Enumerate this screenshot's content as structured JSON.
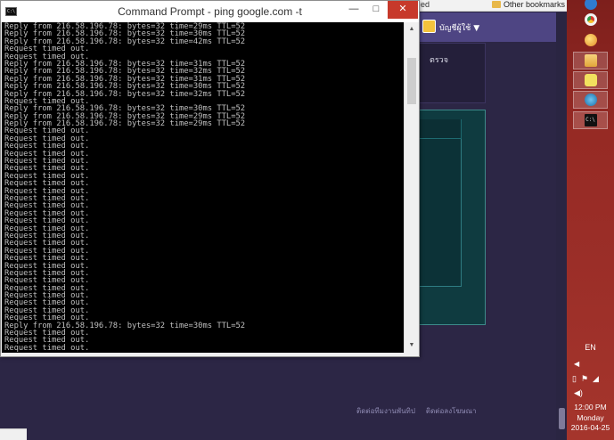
{
  "browser": {
    "bookmark_fragment": "ed",
    "other_bookmarks": "Other bookmarks",
    "account_label": "บัญชีผู้ใช้",
    "account_caret": "▼",
    "panel_text": "ตรวจ",
    "footer_links": [
      "ติดต่อทีมงานพันทิป",
      "ติดต่อลงโฆษณา"
    ]
  },
  "cmd": {
    "title": "Command Prompt - ping  google.com -t",
    "icon_label": "C:\\",
    "buttons": {
      "minimize": "—",
      "maximize": "□",
      "close": "✕"
    },
    "lines": [
      "Reply from 216.58.196.78: bytes=32 time=29ms TTL=52",
      "Reply from 216.58.196.78: bytes=32 time=30ms TTL=52",
      "Reply from 216.58.196.78: bytes=32 time=42ms TTL=52",
      "Request timed out.",
      "Request timed out.",
      "Reply from 216.58.196.78: bytes=32 time=31ms TTL=52",
      "Reply from 216.58.196.78: bytes=32 time=32ms TTL=52",
      "Reply from 216.58.196.78: bytes=32 time=31ms TTL=52",
      "Reply from 216.58.196.78: bytes=32 time=30ms TTL=52",
      "Reply from 216.58.196.78: bytes=32 time=32ms TTL=52",
      "Request timed out.",
      "Reply from 216.58.196.78: bytes=32 time=30ms TTL=52",
      "Reply from 216.58.196.78: bytes=32 time=29ms TTL=52",
      "Reply from 216.58.196.78: bytes=32 time=29ms TTL=52",
      "Request timed out.",
      "Request timed out.",
      "Request timed out.",
      "Request timed out.",
      "Request timed out.",
      "Request timed out.",
      "Request timed out.",
      "Request timed out.",
      "Request timed out.",
      "Request timed out.",
      "Request timed out.",
      "Request timed out.",
      "Request timed out.",
      "Request timed out.",
      "Request timed out.",
      "Request timed out.",
      "Request timed out.",
      "Request timed out.",
      "Request timed out.",
      "Request timed out.",
      "Request timed out.",
      "Request timed out.",
      "Request timed out.",
      "Request timed out.",
      "Request timed out.",
      "Request timed out.",
      "Reply from 216.58.196.78: bytes=32 time=30ms TTL=52",
      "Request timed out.",
      "Request timed out.",
      "Request timed out."
    ]
  },
  "taskbar": {
    "icons": [
      "ie-icon",
      "chrome-icon",
      "paint-icon",
      "explorer-icon",
      "chat-icon",
      "globe-icon",
      "cmd-icon"
    ],
    "language": "EN",
    "tray_arrow": "◀",
    "clock_time": "12:00 PM",
    "clock_day": "Monday",
    "clock_date": "2016-04-25"
  },
  "colors": {
    "taskbar": "#9b2e28",
    "page_background": "#2c2645",
    "console_background": "#000000",
    "console_text": "#c0c0c0",
    "close_button": "#c7392b"
  }
}
